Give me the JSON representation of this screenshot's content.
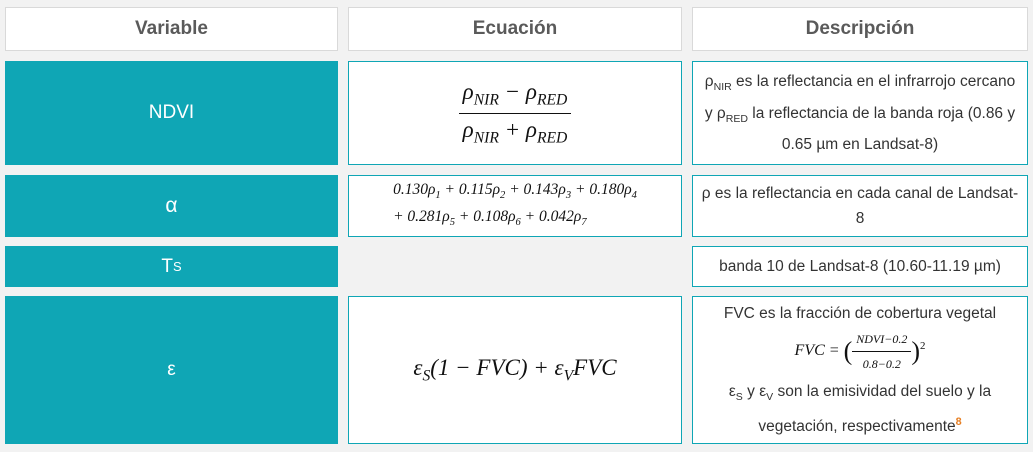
{
  "headers": {
    "variable": "Variable",
    "equation": "Ecuación",
    "description": "Descripción"
  },
  "rows": [
    {
      "variable": "NDVI",
      "equation": {
        "num": "ρNIR − ρRED",
        "den": "ρNIR + ρRED"
      },
      "description": "ρNIR es la reflectancia en el infrarrojo cercano y ρRED la reflectancia de la banda roja (0.86 y 0.65 µm en Landsat-8)"
    },
    {
      "variable": "α",
      "equation": {
        "line1": "0.130ρ1 + 0.115ρ2 + 0.143ρ3 + 0.180ρ4",
        "line2": "+ 0.281ρ5 + 0.108ρ6 + 0.042ρ7"
      },
      "description": "ρ es la reflectancia en cada canal de Landsat-8"
    },
    {
      "variable": "TS",
      "equation": "",
      "description": "banda 10 de Landsat-8 (10.60-11.19 µm)"
    },
    {
      "variable": "ε",
      "equation": "εS(1 − FVC) + εVFVC",
      "description": {
        "line1": "FVC es la fracción de cobertura vegetal",
        "formula_lhs": "FVC =",
        "formula_num": "NDVI−0.2",
        "formula_den": "0.8−0.2",
        "formula_exp": "2",
        "line3": "εS y εV son la emisividad del suelo y la vegetación, respectivamente",
        "ref": "8"
      }
    }
  ],
  "colors": {
    "accent": "#0fa6b5",
    "header_text": "#5a5a5a",
    "ref": "#e67e22"
  }
}
